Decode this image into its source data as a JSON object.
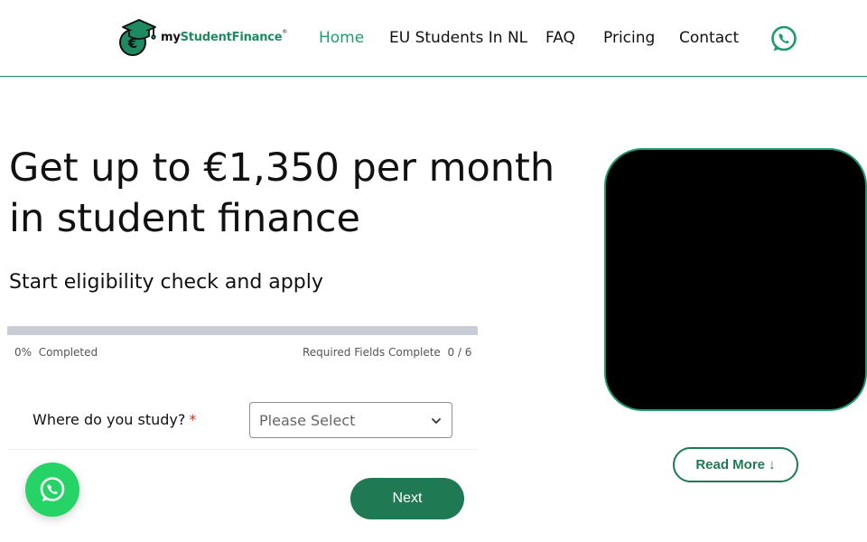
{
  "header": {
    "logo": {
      "text_prefix": "my",
      "text_main": "StudentFinance",
      "trademark": "®",
      "icon": "graduation-cap-euro-icon"
    },
    "nav": [
      {
        "label": "Home",
        "active": true
      },
      {
        "label": "EU Students In NL",
        "active": false
      },
      {
        "label": "FAQ",
        "active": false
      },
      {
        "label": "Pricing",
        "active": false
      },
      {
        "label": "Contact",
        "active": false
      }
    ],
    "whatsapp_icon": "whatsapp-icon"
  },
  "hero": {
    "title": "Get up to €1,350 per month in student finance",
    "subtitle": "Start eligibility check and apply"
  },
  "form": {
    "progress": {
      "percent": 0,
      "percent_text": "0%",
      "completed_label": "Completed",
      "required_label": "Required Fields Complete",
      "required_count": "0 / 6"
    },
    "field": {
      "label": "Where do you study?",
      "required_mark": "*",
      "placeholder": "Please Select"
    },
    "next_label": "Next"
  },
  "video": {
    "present": true
  },
  "read_more": {
    "label": "Read More",
    "arrow": "↓"
  },
  "floating_chat": {
    "icon": "whatsapp-icon"
  },
  "colors": {
    "brand": "#1f8a62",
    "nav_active": "#1f9a6e",
    "button": "#1f7a53",
    "whatsapp": "#25d366",
    "required": "#d0302a"
  }
}
